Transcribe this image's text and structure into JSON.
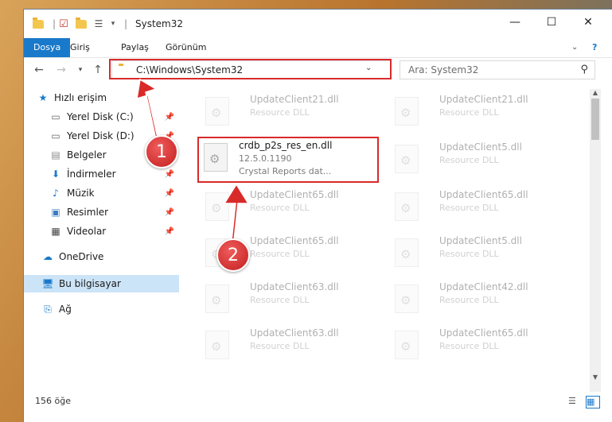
{
  "window": {
    "title": "System32",
    "controls": {
      "minimize": "—",
      "maximize": "☐",
      "close": "✕",
      "help": "?"
    }
  },
  "ribbon": {
    "tabs": [
      "Dosya",
      "Giriş",
      "Paylaş",
      "Görünüm"
    ],
    "chevron": "⌄"
  },
  "address": {
    "path": "C:\\Windows\\System32",
    "search_placeholder": "Ara: System32"
  },
  "sidebar": {
    "items": [
      {
        "label": "Hızlı erişim",
        "icon": "star-icon"
      },
      {
        "label": "Yerel Disk (C:)",
        "icon": "drive-icon",
        "pinned": true
      },
      {
        "label": "Yerel Disk (D:)",
        "icon": "drive-icon",
        "pinned": true
      },
      {
        "label": "Belgeler",
        "icon": "documents-icon",
        "pinned": true
      },
      {
        "label": "İndirmeler",
        "icon": "downloads-icon",
        "pinned": true
      },
      {
        "label": "Müzik",
        "icon": "music-icon",
        "pinned": true
      },
      {
        "label": "Resimler",
        "icon": "pictures-icon",
        "pinned": true
      },
      {
        "label": "Videolar",
        "icon": "videos-icon",
        "pinned": true
      },
      {
        "label": "OneDrive",
        "icon": "cloud-icon"
      },
      {
        "label": "Bu bilgisayar",
        "icon": "computer-icon",
        "selected": true
      },
      {
        "label": "Ağ",
        "icon": "network-icon"
      }
    ]
  },
  "files": {
    "highlighted": {
      "name": "crdb_p2s_res_en.dll",
      "version": "12.5.0.1190",
      "desc": "Crystal Reports dat..."
    },
    "left_column": [
      {
        "name": "UpdateClient21.dll",
        "desc": "Resource DLL"
      },
      {
        "name": "UpdateClient65.dll",
        "desc": "Resource DLL"
      },
      {
        "name": "UpdateClient65.dll",
        "desc": "Resource DLL"
      },
      {
        "name": "UpdateClient63.dll",
        "desc": "Resource DLL"
      },
      {
        "name": "UpdateClient63.dll",
        "desc": "Resource DLL"
      }
    ],
    "right_column": [
      {
        "name": "UpdateClient21.dll",
        "desc": "Resource DLL"
      },
      {
        "name": "UpdateClient5.dll",
        "desc": "Resource DLL"
      },
      {
        "name": "UpdateClient65.dll",
        "desc": "Resource DLL"
      },
      {
        "name": "UpdateClient5.dll",
        "desc": "Resource DLL"
      },
      {
        "name": "UpdateClient42.dll",
        "desc": "Resource DLL"
      },
      {
        "name": "UpdateClient65.dll",
        "desc": "Resource DLL"
      }
    ]
  },
  "status": {
    "count": "156 öğe"
  },
  "callouts": {
    "one": "1",
    "two": "2"
  },
  "colors": {
    "accent": "#1979ca",
    "highlight": "#d92a2a",
    "selected": "#cce4f7"
  }
}
